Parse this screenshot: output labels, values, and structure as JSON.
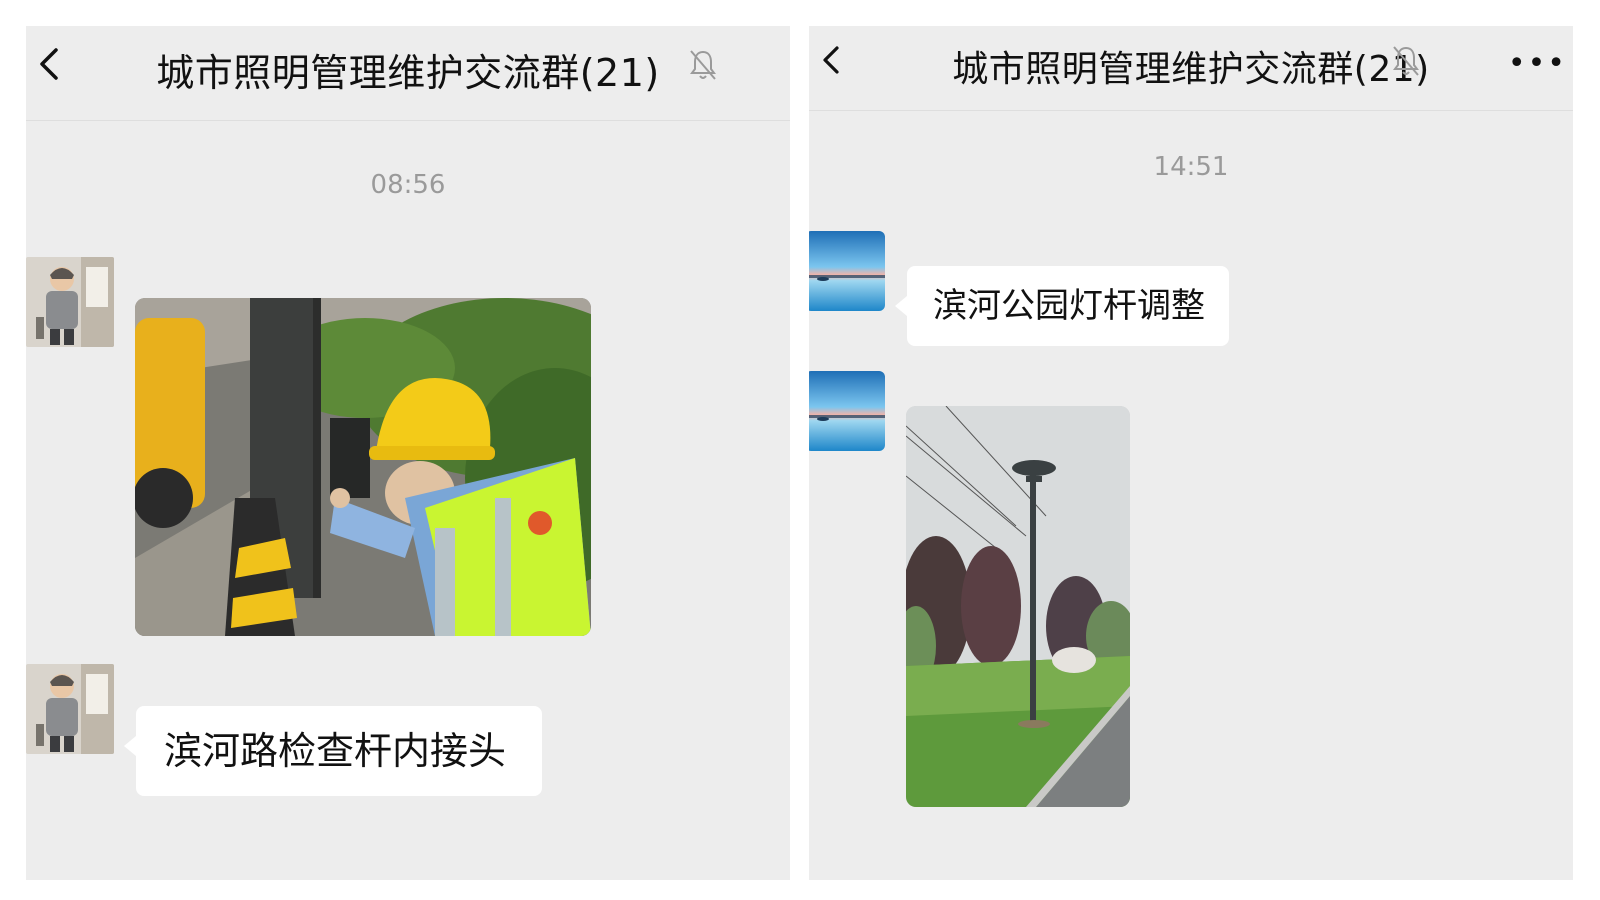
{
  "left_chat": {
    "title": "城市照明管理维护交流群(21)",
    "time": "08:56",
    "messages": [
      {
        "type": "image",
        "description_icon": "worker-photo"
      },
      {
        "type": "text",
        "text": "滨河路检查杆内接头"
      }
    ]
  },
  "right_chat": {
    "title": "城市照明管理维护交流群(21)",
    "time": "14:51",
    "messages": [
      {
        "type": "text",
        "text": "滨河公园灯杆调整"
      },
      {
        "type": "image",
        "description_icon": "lamp-pole-photo"
      }
    ]
  },
  "colors": {
    "chat_background": "#ededed",
    "bubble_background": "#ffffff",
    "timestamp": "#9a9a9a",
    "title_text": "#111111"
  }
}
